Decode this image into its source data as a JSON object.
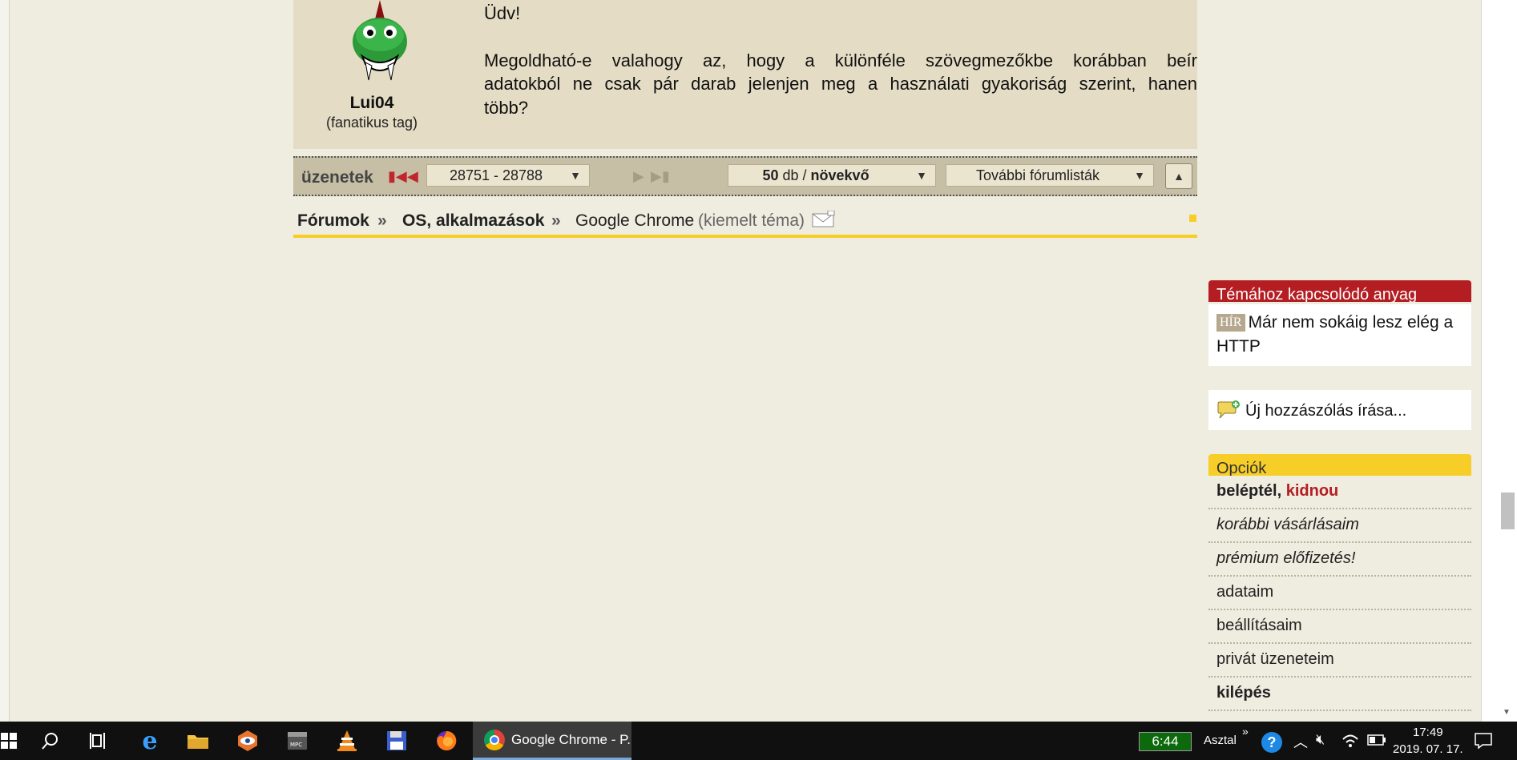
{
  "post": {
    "username": "Lui04",
    "user_title": "(fanatikus tag)",
    "greeting": "Üdv!",
    "body_lines": [
      "Megoldható-e valahogy az, hogy a különféle szövegmezőkbe korábban beír",
      "adatokból ne csak pár darab jelenjen meg a használati gyakoriság szerint, hanen",
      "több?"
    ]
  },
  "navbar": {
    "label": "üzenetek",
    "range": "28751 - 28788",
    "per_page_count": "50",
    "per_page_unit": "db /",
    "order": "növekvő",
    "more_lists": "További fórumlisták"
  },
  "breadcrumb": {
    "forums": "Fórumok",
    "sep": "»",
    "category": "OS, alkalmazások",
    "topic": "Google Chrome",
    "topic_note": "(kiemelt téma)"
  },
  "sidebar": {
    "related_header": "Témához kapcsolódó anyag",
    "related_tag": "HÍR",
    "related_title": "Már nem sokáig lesz elég a HTTP",
    "new_post": "Új hozzászólás írása...",
    "options_header": "Opciók",
    "logged_in_prefix": "beléptél,",
    "logged_in_user": "kidnou",
    "options": [
      "korábbi vásárlásaim",
      "prémium előfizetés!",
      "adataim",
      "beállításaim",
      "privát üzeneteim",
      "kilépés"
    ]
  },
  "taskbar": {
    "active_window": "Google Chrome - P...",
    "battery_time": "6:44",
    "desktop_label": "Asztal",
    "chevron": "»",
    "time": "17:49",
    "date": "2019. 07. 17."
  },
  "colors": {
    "page_bg": "#efece0",
    "post_bg": "#e4dcc4",
    "accent_red": "#b41e23",
    "accent_yellow": "#f7cd28"
  }
}
